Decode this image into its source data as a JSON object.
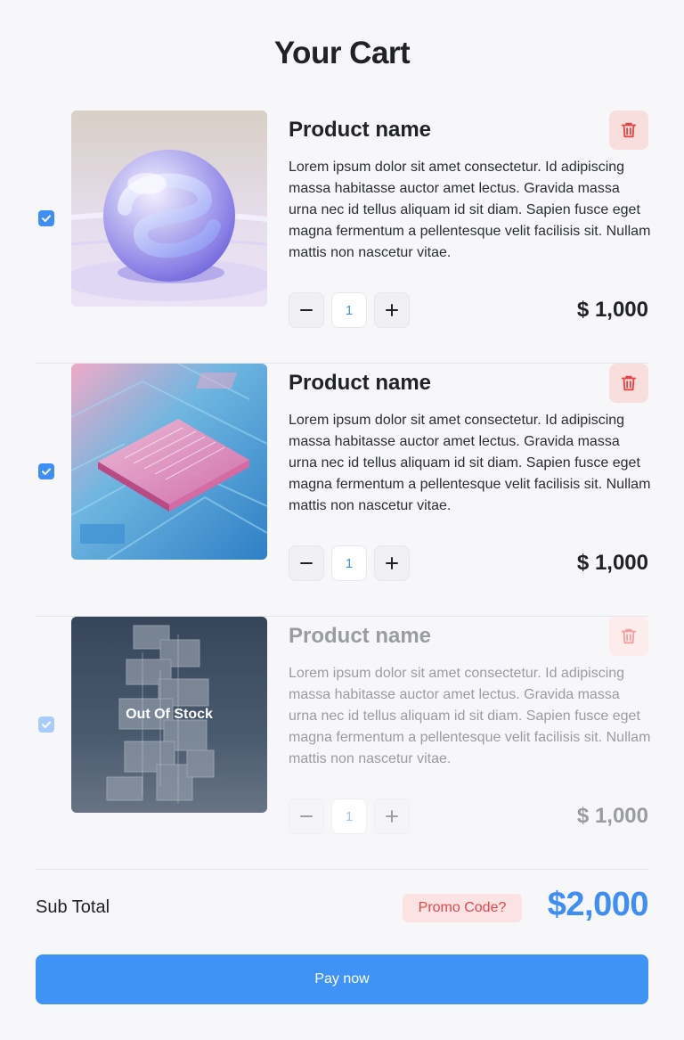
{
  "header": {
    "title": "Your Cart"
  },
  "items": [
    {
      "name": "Product name",
      "description": "Lorem ipsum dolor sit amet consectetur. Id adipiscing massa habitasse auctor amet lectus. Gravida massa urna nec id tellus aliquam id sit diam. Sapien fusce eget magna fermentum a pellentesque velit facilisis sit. Nullam mattis non nascetur vitae.",
      "quantity": "1",
      "price": "$ 1,000",
      "checked": true,
      "image_icon": "glass-sphere-image"
    },
    {
      "name": "Product name",
      "description": "Lorem ipsum dolor sit amet consectetur. Id adipiscing massa habitasse auctor amet lectus. Gravida massa urna nec id tellus aliquam id sit diam. Sapien fusce eget magna fermentum a pellentesque velit facilisis sit. Nullam mattis non nascetur vitae.",
      "quantity": "1",
      "price": "$ 1,000",
      "checked": true,
      "image_icon": "circuit-chip-image"
    },
    {
      "name": "Product name",
      "description": "Lorem ipsum dolor sit amet consectetur. Id adipiscing massa habitasse auctor amet lectus. Gravida massa urna nec id tellus aliquam id sit diam. Sapien fusce eget magna fermentum a pellentesque velit facilisis sit. Nullam mattis non nascetur vitae.",
      "quantity": "1",
      "price": "$ 1,000",
      "checked": true,
      "disabled": true,
      "overlay_label": "Out Of Stock",
      "image_icon": "glass-tower-image"
    }
  ],
  "summary": {
    "subtotal_label": "Sub Total",
    "promo_label": "Promo Code?",
    "total": "$2,000"
  },
  "actions": {
    "pay_label": "Pay now"
  },
  "colors": {
    "accent": "#4093f6",
    "danger": "#e2474a",
    "danger_bg": "#f9dede",
    "text": "#202226",
    "muted": "#9a9ca1",
    "background": "#f7f7f9"
  },
  "icons": {
    "checkbox": "check-icon",
    "delete": "trash-icon",
    "decrement": "minus-icon",
    "increment": "plus-icon"
  }
}
